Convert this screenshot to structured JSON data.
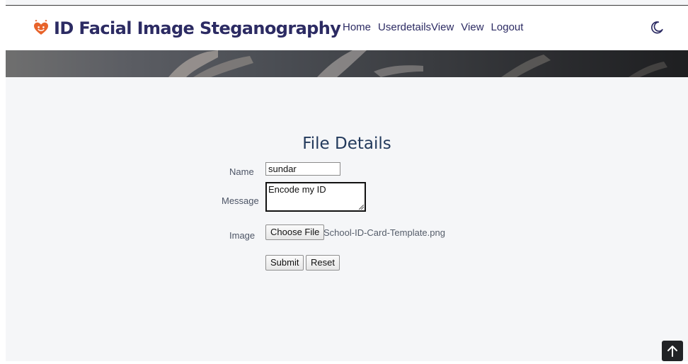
{
  "header": {
    "brand_title": "ID Facial Image Steganography",
    "brand_icon": "bootstrap-heart-icon",
    "nav": [
      {
        "label": "Home"
      },
      {
        "label": "UserdetailsView"
      },
      {
        "label": "View"
      },
      {
        "label": "Logout"
      }
    ],
    "theme_toggle_icon": "moon-icon"
  },
  "form": {
    "title": "File Details",
    "name_label": "Name",
    "name_value": "sundar",
    "message_label": "Message",
    "message_value": "Encode my ID",
    "image_label": "Image",
    "choose_file_label": "Choose File",
    "selected_file": "School-ID-Card-Template.png",
    "submit_label": "Submit",
    "reset_label": "Reset"
  },
  "back_to_top_icon": "arrow-up-icon",
  "colors": {
    "brand": "#2c2b63",
    "accent": "#e8632a",
    "title": "#233a5c",
    "background": "#f5f6f8"
  }
}
